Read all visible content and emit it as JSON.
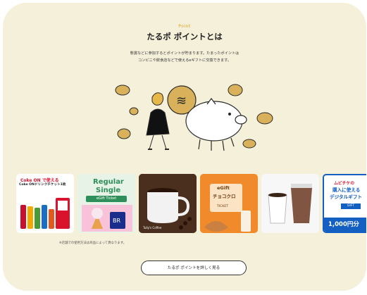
{
  "header": {
    "eyebrow": "Point",
    "title": "たるポ ポイントとは",
    "desc_line1": "懸賞などに参加するとポイントが貯まります。たまったポイントは",
    "desc_line2": "コンビニや飲食店などで使えるeギフトに交換できます。"
  },
  "tiles": [
    {
      "name": "coke-on-ticket",
      "l1": "Coke ON で使える",
      "l2": "Coke ONドリンクチケット1枚"
    },
    {
      "name": "regular-single",
      "l1": "Regular",
      "l2": "Single",
      "l3": "eGift Ticket"
    },
    {
      "name": "tullys-coffee",
      "l1": "Tully's Coffee"
    },
    {
      "name": "choco-cro",
      "l1": "eGift",
      "l2": "チョコクロ",
      "l3": "TICKET"
    },
    {
      "name": "coffee-cups"
    },
    {
      "name": "digital-gift",
      "l1": "ムビチケの",
      "l2": "購入に使える",
      "l3": "デジタルギフト",
      "l4": "GIFT",
      "l5": "1,000円分"
    }
  ],
  "note": "※店舗での使用方法は商品によって異なります。",
  "cta": {
    "label": "たるポ ポイントを詳しく見る"
  },
  "colors": {
    "card_bg": "#f5f0da",
    "accent": "#e0a020",
    "blue": "#1460c2"
  }
}
